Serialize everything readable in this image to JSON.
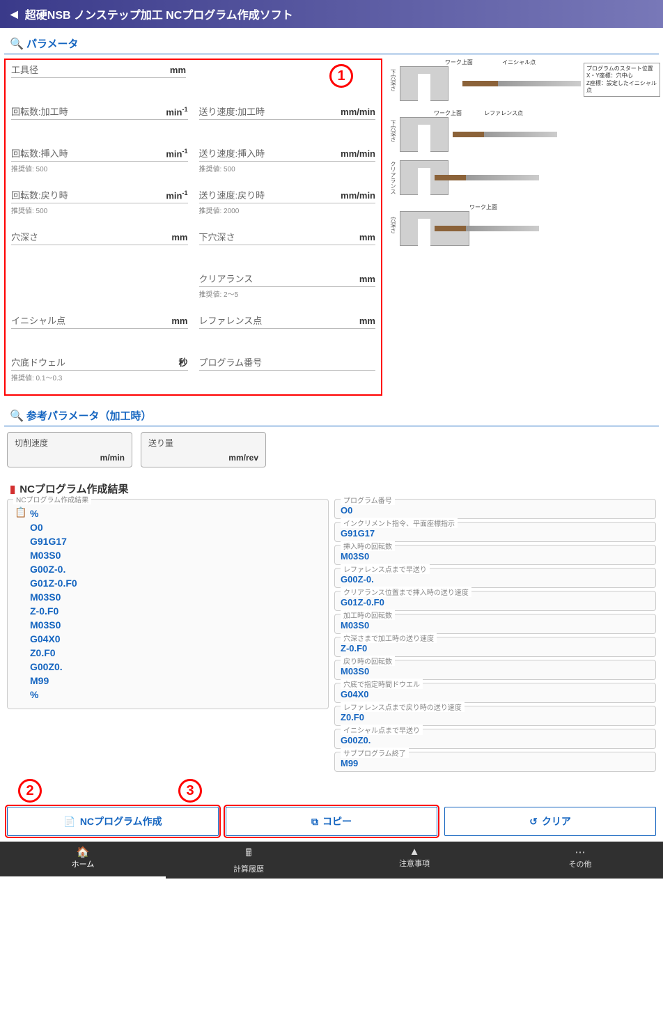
{
  "header": {
    "title": "超硬NSB ノンステップ加工 NCプログラム作成ソフト"
  },
  "sections": {
    "params": "パラメータ",
    "refParams": "参考パラメータ（加工時）",
    "ncResult": "NCプログラム作成結果"
  },
  "annotations": {
    "one": "1",
    "two": "2",
    "three": "3"
  },
  "params": {
    "toolDiameter": {
      "label": "工具径",
      "unit": "mm"
    },
    "rpmMachining": {
      "label": "回転数:加工時",
      "unit": "min",
      "sup": "-1"
    },
    "feedMachining": {
      "label": "送り速度:加工時",
      "unit": "mm/min"
    },
    "rpmInsert": {
      "label": "回転数:挿入時",
      "unit": "min",
      "sup": "-1",
      "hint": "推奨値: 500"
    },
    "feedInsert": {
      "label": "送り速度:挿入時",
      "unit": "mm/min",
      "hint": "推奨値: 500"
    },
    "rpmReturn": {
      "label": "回転数:戻り時",
      "unit": "min",
      "sup": "-1",
      "hint": "推奨値: 500"
    },
    "feedReturn": {
      "label": "送り速度:戻り時",
      "unit": "mm/min",
      "hint": "推奨値: 2000"
    },
    "holeDepth": {
      "label": "穴深さ",
      "unit": "mm"
    },
    "pilotHoleDepth": {
      "label": "下穴深さ",
      "unit": "mm"
    },
    "clearance": {
      "label": "クリアランス",
      "unit": "mm",
      "hint": "推奨値: 2～5"
    },
    "initialPoint": {
      "label": "イニシャル点",
      "unit": "mm"
    },
    "referencePoint": {
      "label": "レファレンス点",
      "unit": "mm"
    },
    "dwell": {
      "label": "穴底ドウェル",
      "unit": "秒",
      "hint": "推奨値: 0.1～0.3"
    },
    "programNumber": {
      "label": "プログラム番号"
    }
  },
  "diagramNote": {
    "line1": "プログラムのスタート位置",
    "line2": "X・Y座標：穴中心",
    "line3": "Z座標：設定したイニシャル点"
  },
  "diagramLabels": {
    "pilotDepth": "下穴深さ",
    "workTop": "ワーク上面",
    "initial": "イニシャル点",
    "reference": "レファレンス点",
    "clearance": "クリアランス",
    "holeDepth": "穴深さ"
  },
  "refParams": {
    "cuttingSpeed": {
      "label": "切削速度",
      "unit": "m/min"
    },
    "feedAmount": {
      "label": "送り量",
      "unit": "mm/rev"
    }
  },
  "ncProgram": {
    "fieldsetLabel": "NCプログラム作成結果",
    "lines": [
      "%",
      "O0",
      "G91G17",
      "M03S0",
      "G00Z-0.",
      "G01Z-0.F0",
      "M03S0",
      "Z-0.F0",
      "M03S0",
      "G04X0",
      "Z0.F0",
      "G00Z0.",
      "M99",
      "%"
    ]
  },
  "ncItems": [
    {
      "label": "プログラム番号",
      "value": "O0"
    },
    {
      "label": "インクリメント指令、平面座標指示",
      "value": "G91G17"
    },
    {
      "label": "挿入時の回転数",
      "value": "M03S0"
    },
    {
      "label": "レファレンス点まで早送り",
      "value": "G00Z-0."
    },
    {
      "label": "クリアランス位置まで挿入時の送り速度",
      "value": "G01Z-0.F0"
    },
    {
      "label": "加工時の回転数",
      "value": "M03S0"
    },
    {
      "label": "穴深さまで加工時の送り速度",
      "value": "Z-0.F0"
    },
    {
      "label": "戻り時の回転数",
      "value": "M03S0"
    },
    {
      "label": "穴底で指定時間ドウエル",
      "value": "G04X0"
    },
    {
      "label": "レファレンス点まで戻り時の送り速度",
      "value": "Z0.F0"
    },
    {
      "label": "イニシャル点まで早送り",
      "value": "G00Z0."
    },
    {
      "label": "サブプログラム終了",
      "value": "M99"
    }
  ],
  "buttons": {
    "create": "NCプログラム作成",
    "copy": "コピー",
    "clear": "クリア"
  },
  "nav": {
    "home": "ホーム",
    "history": "計算履歴",
    "caution": "注意事項",
    "other": "その他"
  }
}
